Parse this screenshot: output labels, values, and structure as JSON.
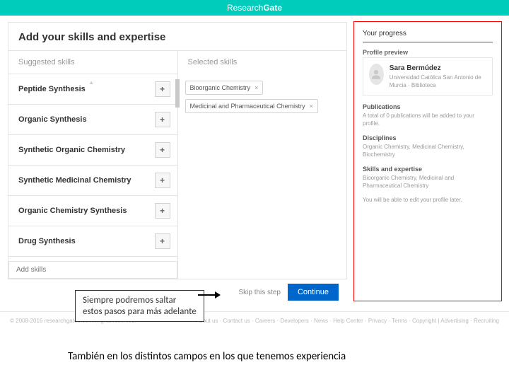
{
  "brand": {
    "thin": "Research",
    "bold": "Gate"
  },
  "skills": {
    "heading": "Add your skills and expertise",
    "suggested_label": "Suggested skills",
    "selected_label": "Selected skills",
    "suggested": [
      "Peptide Synthesis",
      "Organic Synthesis",
      "Synthetic Organic Chemistry",
      "Synthetic Medicinal Chemistry",
      "Organic Chemistry Synthesis",
      "Drug Synthesis"
    ],
    "selected": [
      "Bioorganic Chemistry",
      "Medicinal and Pharmaceutical Chemistry"
    ],
    "add_placeholder": "Add skills"
  },
  "actions": {
    "skip": "Skip this step",
    "continue": "Continue"
  },
  "sidebar": {
    "title": "Your progress",
    "preview": "Profile preview",
    "name": "Sara Bermúdez",
    "affiliation": "Universidad Católica San Antonio de Murcia · Biblioteca",
    "pubs_label": "Publications",
    "pubs_text": "A total of 0 publications will be added to your profile.",
    "disc_label": "Disciplines",
    "disc_text": "Organic Chemistry, Medicinal Chemistry, Biochemistry",
    "sk_label": "Skills and expertise",
    "sk_text": "Bioorganic Chemistry, Medicinal and Pharmaceutical Chemistry",
    "note": "You will be able to edit your profile later."
  },
  "footer": {
    "copyright": "© 2008-2016 researchgate.net. All rights reserved.",
    "links": "About us · Contact us · Careers · Developers · News · Help Center · Privacy · Terms · Copyright  |  Advertising · Recruiting"
  },
  "annotations": {
    "box": "Siempre podremos  saltar\nestos pasos para más adelante",
    "caption2": "También en los distintos campos en los que tenemos experiencia"
  }
}
